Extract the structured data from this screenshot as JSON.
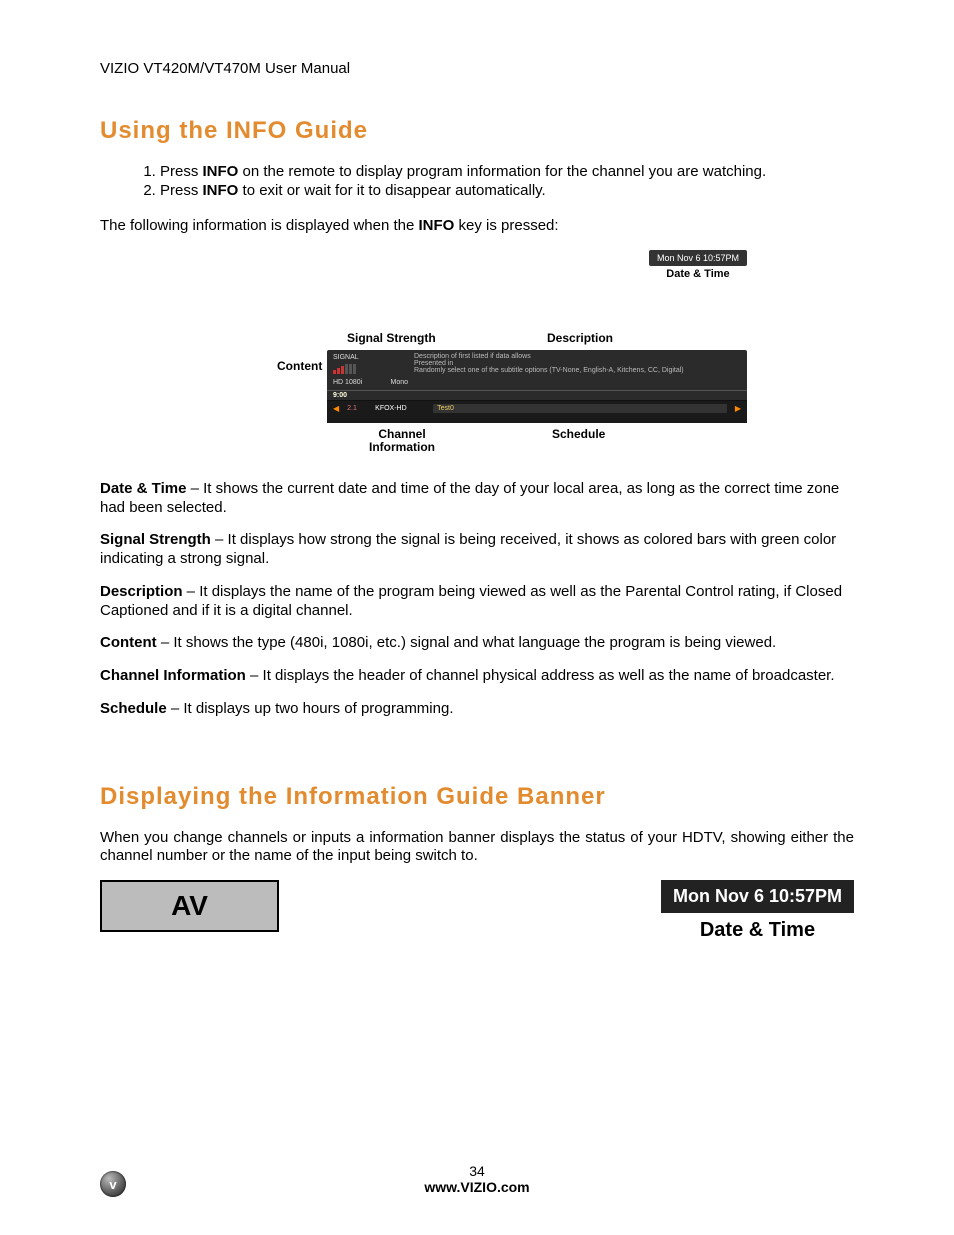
{
  "header": {
    "runhead": "VIZIO VT420M/VT470M User Manual"
  },
  "section1": {
    "title": "Using the INFO Guide",
    "steps": [
      {
        "pre": "Press ",
        "bold": "INFO",
        "post": " on the remote to display program information for the channel you are watching."
      },
      {
        "pre": "Press ",
        "bold": "INFO",
        "post": " to exit or wait for it to disappear automatically."
      }
    ],
    "lead_pre": "The following information is displayed when the ",
    "lead_bold": "INFO",
    "lead_post": " key is pressed:",
    "diagram": {
      "datetime_pill": "Mon Nov 6 10:57PM",
      "datetime_cap": "Date & Time",
      "label_signal": "Signal Strength",
      "label_desc": "Description",
      "label_content": "Content",
      "label_chinfo": "Channel Information",
      "label_sched": "Schedule",
      "osd": {
        "sigword": "SIGNAL",
        "res": "HD 1080i",
        "mono": "Mono",
        "desc1": "Description of first listed if data allows",
        "desc2": "Presented in",
        "desc3": "Randomly select one of the subtitle options (TV-None, English-A, Kitchens, CC, Digital)",
        "schedtime": "9:00",
        "ch": "2.1",
        "chname": "KFOX-HD",
        "prog": "Test0"
      }
    },
    "defs": [
      {
        "term": "Date & Time",
        "text": " – It shows the current date and time of the day of your local area, as long as the correct time zone had been selected."
      },
      {
        "term": "Signal Strength",
        "text": " – It displays how strong the signal is being received, it shows as colored bars with green color indicating a strong signal."
      },
      {
        "term": "Description",
        "text": " – It displays the name of the program being viewed as well as the Parental Control rating, if Closed Captioned and if it is a digital channel."
      },
      {
        "term": "Content",
        "text": " – It shows the type (480i, 1080i, etc.) signal and what language the program is being viewed."
      },
      {
        "term": "Channel Information",
        "text": " – It displays the header of channel physical address as well as the name of broadcaster."
      },
      {
        "term": "Schedule",
        "text": " – It displays up two hours of programming."
      }
    ]
  },
  "section2": {
    "title": "Displaying the Information Guide Banner",
    "lead": "When you change channels or inputs a information banner displays the status of your HDTV, showing either the channel number or the name of the input being switch to.",
    "av_label": "AV",
    "dt_big": "Mon Nov 6 10:57PM",
    "dt_cap": "Date & Time"
  },
  "footer": {
    "page": "34",
    "site": "www.VIZIO.com",
    "logo_letter": "v"
  }
}
